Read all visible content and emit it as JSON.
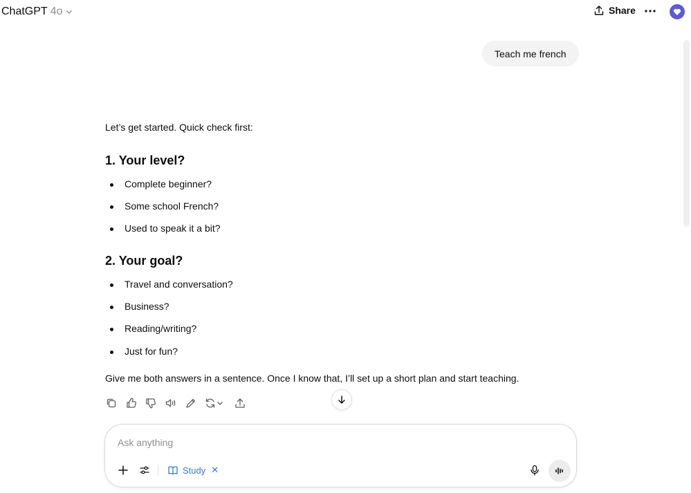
{
  "header": {
    "model_name": "ChatGPT",
    "model_version": "4o",
    "share_label": "Share",
    "icons": [
      "chevron-down-icon",
      "share-icon",
      "more-icon",
      "profile-icon"
    ]
  },
  "conversation": {
    "user_message": "Teach me french",
    "assistant": {
      "intro": "Let’s get started. Quick check first:",
      "sections": [
        {
          "heading": "1. Your level?",
          "items": [
            "Complete beginner?",
            "Some school French?",
            "Used to speak it a bit?"
          ]
        },
        {
          "heading": "2. Your goal?",
          "items": [
            "Travel and conversation?",
            "Business?",
            "Reading/writing?",
            "Just for fun?"
          ]
        }
      ],
      "outro": "Give me both answers in a sentence. Once I know that, I’ll set up a short plan and start teaching."
    },
    "action_icons": [
      "copy-icon",
      "thumbs-up-icon",
      "thumbs-down-icon",
      "read-aloud-icon",
      "edit-icon",
      "regenerate-icon",
      "share-icon"
    ]
  },
  "composer": {
    "placeholder": "Ask anything",
    "value": "",
    "tool_chip": "Study",
    "icons": [
      "plus-icon",
      "tools-icon",
      "book-icon",
      "close-icon",
      "microphone-icon",
      "voice-mode-icon"
    ]
  },
  "colors": {
    "accent": "#2f7bd9",
    "avatar": "#5b5bd6",
    "bubble": "#f3f3f3"
  }
}
